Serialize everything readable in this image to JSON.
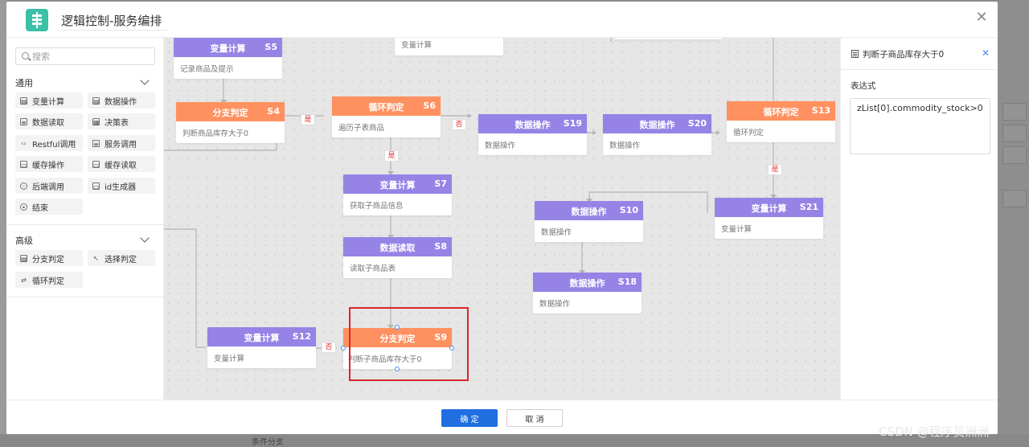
{
  "modal": {
    "title": "逻辑控制-服务编排",
    "close": "✕"
  },
  "search": {
    "placeholder": "搜索"
  },
  "palette": {
    "groups": [
      {
        "title": "通用",
        "items": [
          "变量计算",
          "数据操作",
          "数据读取",
          "决策表",
          "Restful调用",
          "服务调用",
          "缓存操作",
          "缓存读取",
          "后端调用",
          "id生成器",
          "结束"
        ]
      },
      {
        "title": "高级",
        "items": [
          "分支判定",
          "选择判定",
          "循环判定"
        ]
      }
    ]
  },
  "nodes": [
    {
      "id": "S5",
      "title": "变量计算",
      "desc": "记录商品及提示",
      "color": "purple"
    },
    {
      "id": "",
      "title": "",
      "desc": "变量计算",
      "color": "none"
    },
    {
      "id": "S4",
      "title": "分支判定",
      "desc": "判断商品库存大于0",
      "color": "orange"
    },
    {
      "id": "S6",
      "title": "循环判定",
      "desc": "遍历子表商品",
      "color": "orange"
    },
    {
      "id": "S19",
      "title": "数据操作",
      "desc": "数据操作",
      "color": "purple"
    },
    {
      "id": "S20",
      "title": "数据操作",
      "desc": "数据操作",
      "color": "purple"
    },
    {
      "id": "S13",
      "title": "循环判定",
      "desc": "循环判定",
      "color": "orange"
    },
    {
      "id": "S7",
      "title": "变量计算",
      "desc": "获取子商品信息",
      "color": "purple"
    },
    {
      "id": "S8",
      "title": "数据读取",
      "desc": "读取子商品表",
      "color": "purple"
    },
    {
      "id": "S10",
      "title": "数据操作",
      "desc": "数据操作",
      "color": "purple"
    },
    {
      "id": "S18",
      "title": "数据操作",
      "desc": "数据操作",
      "color": "purple"
    },
    {
      "id": "S21",
      "title": "变量计算",
      "desc": "变量计算",
      "color": "purple"
    },
    {
      "id": "S12",
      "title": "变量计算",
      "desc": "变量计算",
      "color": "purple"
    },
    {
      "id": "S9",
      "title": "分支判定",
      "desc": "判断子商品库存大于0",
      "color": "orange"
    }
  ],
  "tags": {
    "yes": "是",
    "no": "否"
  },
  "props": {
    "title": "判断子商品库存大于0",
    "label": "表达式",
    "expression": "zList[0].commodity_stock>0",
    "close": "✕"
  },
  "footer": {
    "ok": "确 定",
    "cancel": "取 消"
  },
  "background": {
    "bottom_text": "条件分支"
  },
  "watermark": "CSDN @程序员洲洲",
  "colors": {
    "purple": "#9683e6",
    "orange": "#ff9160",
    "primary": "#1f6fe0",
    "highlight": "#d8262b"
  }
}
